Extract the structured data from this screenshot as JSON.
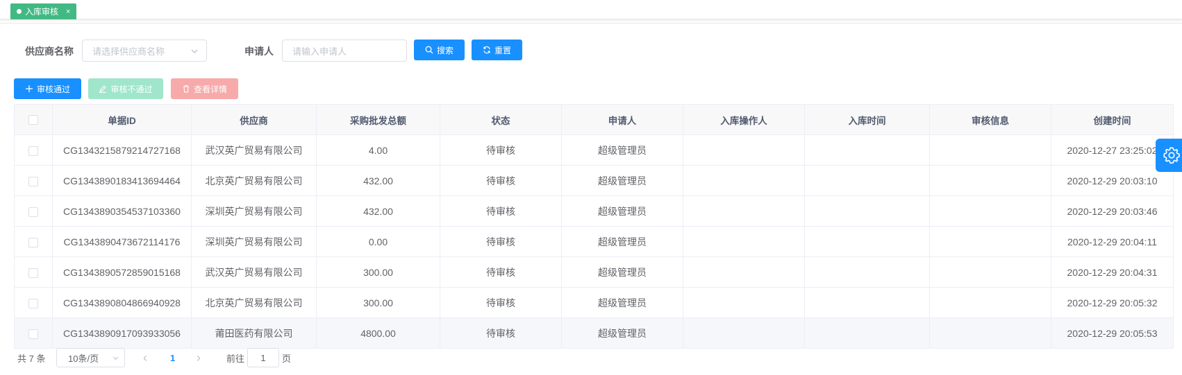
{
  "tab": {
    "label": "入库审核",
    "close": "×"
  },
  "filters": {
    "supplier_label": "供应商名称",
    "supplier_placeholder": "请选择供应商名称",
    "applicant_label": "申请人",
    "applicant_placeholder": "请输入申请人",
    "search_label": "搜索",
    "reset_label": "重置"
  },
  "toolbar": {
    "approve": "审核通过",
    "reject": "审核不通过",
    "detail": "查看详情"
  },
  "table": {
    "columns": [
      "单据ID",
      "供应商",
      "采购批发总额",
      "状态",
      "申请人",
      "入库操作人",
      "入库时间",
      "审核信息",
      "创建时间"
    ],
    "rows": [
      [
        "CG1343215879214727168",
        "武汉英广贸易有限公司",
        "4.00",
        "待审核",
        "超级管理员",
        "",
        "",
        "",
        "2020-12-27 23:25:02"
      ],
      [
        "CG1343890183413694464",
        "北京英广贸易有限公司",
        "432.00",
        "待审核",
        "超级管理员",
        "",
        "",
        "",
        "2020-12-29 20:03:10"
      ],
      [
        "CG1343890354537103360",
        "深圳英广贸易有限公司",
        "432.00",
        "待审核",
        "超级管理员",
        "",
        "",
        "",
        "2020-12-29 20:03:46"
      ],
      [
        "CG1343890473672114176",
        "深圳英广贸易有限公司",
        "0.00",
        "待审核",
        "超级管理员",
        "",
        "",
        "",
        "2020-12-29 20:04:11"
      ],
      [
        "CG1343890572859015168",
        "武汉英广贸易有限公司",
        "300.00",
        "待审核",
        "超级管理员",
        "",
        "",
        "",
        "2020-12-29 20:04:31"
      ],
      [
        "CG1343890804866940928",
        "北京英广贸易有限公司",
        "300.00",
        "待审核",
        "超级管理员",
        "",
        "",
        "",
        "2020-12-29 20:05:32"
      ],
      [
        "CG1343890917093933056",
        "莆田医药有限公司",
        "4800.00",
        "待审核",
        "超级管理员",
        "",
        "",
        "",
        "2020-12-29 20:05:53"
      ]
    ]
  },
  "pager": {
    "total": "共 7 条",
    "size": "10条/页",
    "prev": "‹",
    "page": "1",
    "next": "›",
    "goto": "前往",
    "goto_value": "1",
    "page_unit": "页"
  },
  "colors": {
    "primary": "#1890ff",
    "tag": "#42b983"
  }
}
